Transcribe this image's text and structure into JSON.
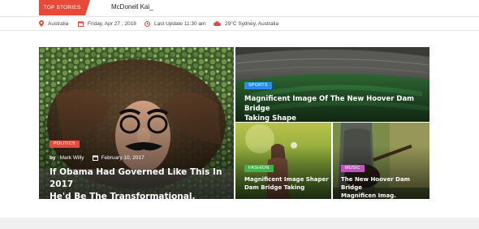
{
  "topbar": {
    "label": "TOP STORIES",
    "ticker": "McDonell Kai_"
  },
  "infobar": {
    "location": "Australia",
    "date": "Friday, Apr 27 , 2018",
    "update": "Last Update 11:30 am",
    "weather": "29°C Sydney, Australia"
  },
  "colors": {
    "top_stories": "#e84a3a",
    "politics": "#e84a3a",
    "sports": "#2a8be8",
    "fashion": "#3bb54a",
    "music": "#c64fc6"
  },
  "featured": {
    "category": "POLITICS",
    "by": "by",
    "author": "Mark Willy",
    "date": "February 10, 2017",
    "title_line1": "If Obama Had Governed Like This In 2017",
    "title_line2": "He'd Be The Transformational."
  },
  "story_sports": {
    "category": "SPORTS",
    "title_line1": "Magnificent Image Of The New Hoover Dam Bridge",
    "title_line2": "Taking Shape"
  },
  "story_fashion": {
    "category": "FASHION",
    "title_line1": "Magnificent Image Shaper",
    "title_line2": "Dam Bridge Taking"
  },
  "story_music": {
    "category": "MUSIC",
    "title_line1": "The New Hoover Dam Bridge",
    "title_line2": "Magnificen Imag."
  }
}
